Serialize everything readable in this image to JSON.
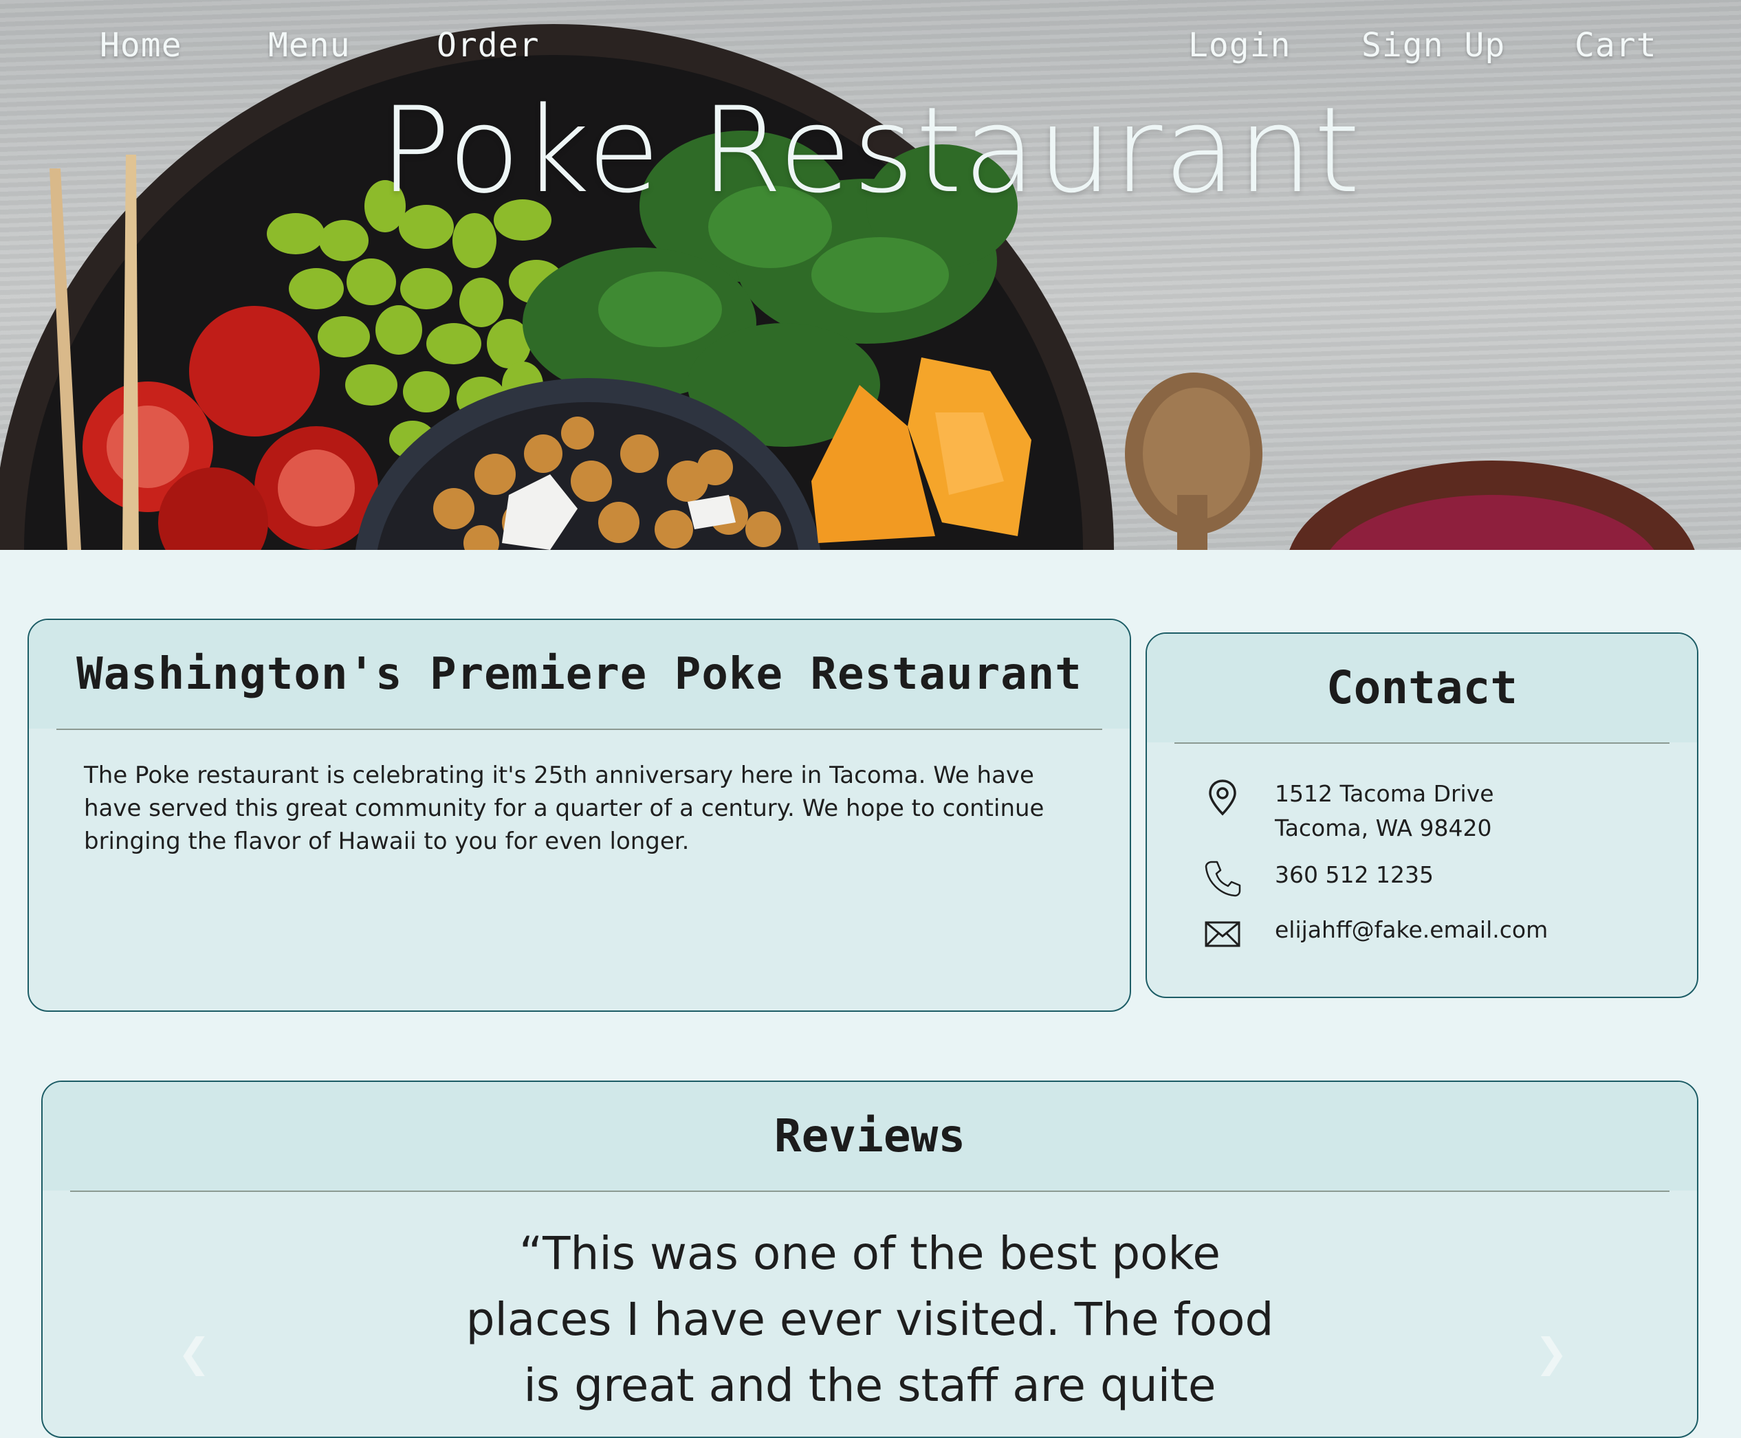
{
  "nav": {
    "home": "Home",
    "menu": "Menu",
    "order": "Order",
    "login": "Login",
    "signup": "Sign Up",
    "cart": "Cart"
  },
  "hero": {
    "title": "Poke Restaurant"
  },
  "about": {
    "heading": "Washington's Premiere Poke Restaurant",
    "body": "The Poke restaurant is celebrating it's 25th anniversary here in Tacoma. We have have served this great community for a quarter of a century. We hope to continue bringing the flavor of Hawaii to you for even longer."
  },
  "contact": {
    "heading": "Contact",
    "address_line1": "1512 Tacoma Drive",
    "address_line2": "Tacoma, WA 98420",
    "phone": "360 512 1235",
    "email": "elijahff@fake.email.com",
    "icons": [
      "location-pin-icon",
      "phone-icon",
      "mail-icon"
    ]
  },
  "reviews": {
    "heading": "Reviews",
    "quote_lines": [
      "“This was one of the best poke",
      "places I have ever visited. The food",
      "is great and the staff are quite"
    ],
    "prev_icon": "chevron-left-icon",
    "next_icon": "chevron-right-icon"
  },
  "colors": {
    "page_bg": "#e9f4f5",
    "card_bg": "#dcedee",
    "card_header_bg": "#d1e8e9",
    "card_border": "#1d5d66",
    "hero_text": "#eef6f6"
  }
}
